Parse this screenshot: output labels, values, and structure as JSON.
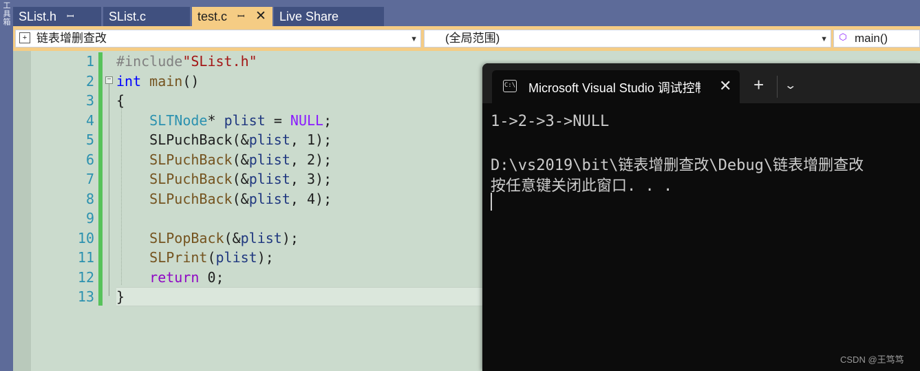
{
  "left_strip_text": "工具箱",
  "tabs": [
    {
      "label": "SList.h",
      "pin": "ꟷ",
      "active": false
    },
    {
      "label": "SList.c",
      "active": false
    },
    {
      "label": "test.c",
      "pin": "ꟷ",
      "close": "✕",
      "active": true
    },
    {
      "label": "Live Share",
      "active": false
    }
  ],
  "nav": {
    "project": "链表增删查改",
    "scope": "(全局范围)",
    "member": "main()",
    "dropdown_icon": "chevron-down-icon"
  },
  "line_numbers": [
    "1",
    "2",
    "3",
    "4",
    "5",
    "6",
    "7",
    "8",
    "9",
    "10",
    "11",
    "12",
    "13"
  ],
  "code": {
    "l1_include": "#include",
    "l1_file": "\"SList.h\"",
    "l2_int": "int",
    "l2_main": "main",
    "l2_paren": "()",
    "l3": "{",
    "l4_type": "SLTNode",
    "l4_star": "* ",
    "l4_var": "plist",
    "l4_eq": " = ",
    "l4_null": "NULL",
    "l4_end": ";",
    "l5_fn": "SLPuchBack",
    "l5_a": "(&",
    "l5_var": "plist",
    "l5_b": ", 1);",
    "l6_fn": "SLPuchBack",
    "l6_a": "(&",
    "l6_var": "plist",
    "l6_b": ", 2);",
    "l7_fn": "SLPuchBack",
    "l7_a": "(&",
    "l7_var": "plist",
    "l7_b": ", 3);",
    "l8_fn": "SLPuchBack",
    "l8_a": "(&",
    "l8_var": "plist",
    "l8_b": ", 4);",
    "l10_fn": "SLPopBack",
    "l10_a": "(&",
    "l10_var": "plist",
    "l10_b": ");",
    "l11_fn": "SLPrint",
    "l11_a": "(",
    "l11_var": "plist",
    "l11_b": ");",
    "l12_ret": "return",
    "l12_b": " 0;",
    "l13": "}"
  },
  "console": {
    "title": "Microsoft Visual Studio 调试控制台",
    "icon_text": "C:\\",
    "close": "✕",
    "new_tab": "+",
    "dropdown": "⌄",
    "lines": [
      "1->2->3->NULL",
      "",
      "D:\\vs2019\\bit\\链表增删查改\\Debug\\链表增删查改",
      "按任意键关闭此窗口. . ."
    ]
  },
  "watermark": "CSDN @王笃笃",
  "colors": {
    "accent_tab": "#f5cc84",
    "editor_bg": "#cbdbcd",
    "change_bar": "#57c25b",
    "console_bg": "#0c0c0c"
  }
}
